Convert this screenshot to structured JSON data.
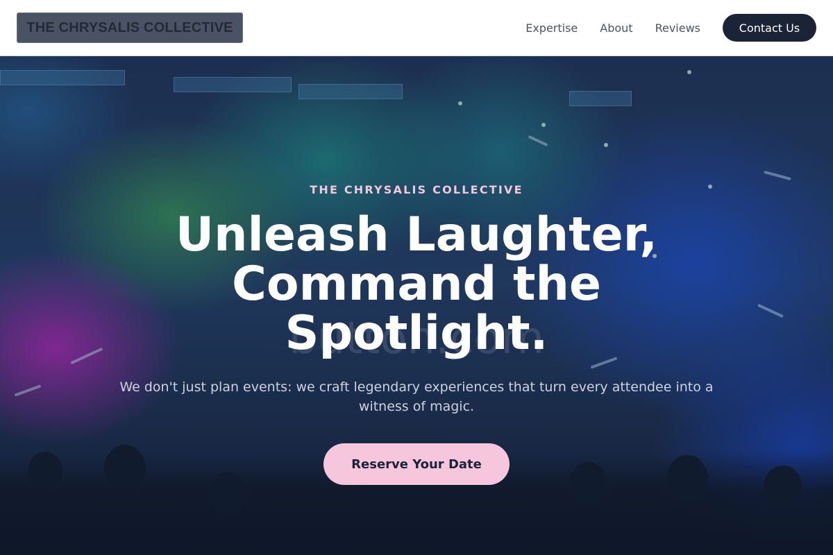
{
  "header": {
    "logo_text": "THE CHRYSALIS COLLECTIVE",
    "nav": [
      {
        "label": "Expertise"
      },
      {
        "label": "About"
      },
      {
        "label": "Reviews"
      }
    ],
    "contact_label": "Contact Us"
  },
  "hero": {
    "eyebrow": "THE CHRYSALIS COLLECTIVE",
    "headline": "Unleash Laughter, Command the Spotlight.",
    "watermark": "button.com",
    "subtext": "We don't just plan events: we craft legendary experiences that turn every attendee into a witness of magic.",
    "cta_label": "Reserve Your Date"
  },
  "colors": {
    "header_bg": "#ffffff",
    "nav_text": "#4b5563",
    "contact_bg": "#1b2436",
    "eyebrow": "#f5c6dc",
    "cta_bg": "#f6c6dc",
    "cta_text": "#1b2436"
  }
}
